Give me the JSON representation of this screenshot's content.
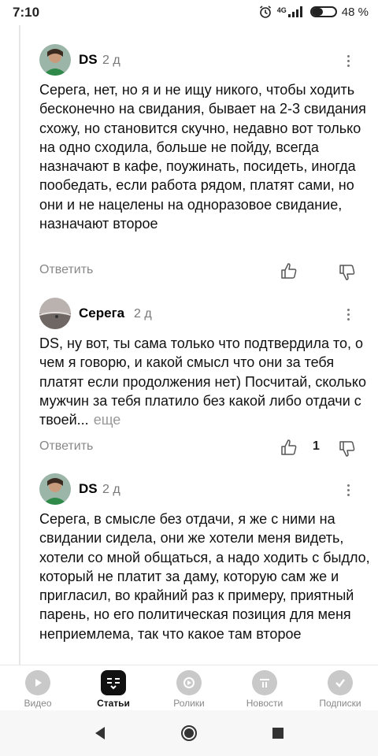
{
  "status_bar": {
    "time": "7:10",
    "network": "4G",
    "battery_percent": "48 %",
    "battery_level": 0.48
  },
  "comments": [
    {
      "author": "DS",
      "age": "2 д",
      "text": "Серега, нет, но я и не ищу никого, чтобы ходить бесконечно на свидания, бывает на 2-3 свидания схожу, но становится скучно, недавно вот только на одно сходила, больше не пойду, всегда назначают в кафе, поужинать, посидеть, иногда пообедать, если работа рядом, платят сами, но они и не нацелены на одноразовое свидание, назначают второе",
      "reply_label": "Ответить"
    },
    {
      "author": "Серега",
      "age": "2 д",
      "text": "DS, ну вот, ты сама только что подтвердила то, о чем я говорю, и какой смысл что они за тебя платят если продолжения нет) Посчитай, сколько мужчин за тебя платило без какой либо отдачи с твоей...",
      "more_label": "еще",
      "reply_label": "Ответить",
      "likes": "1"
    },
    {
      "author": "DS",
      "age": "2 д",
      "text": "Серега, в смысле без отдачи, я же с ними на свидании сидела, они же хотели меня видеть, хотели со мной общаться, а надо ходить с быдло, который не платит за даму, которую сам же и пригласил, во крайний раз к примеру, приятный парень, но его политическая позиция для меня неприемлема, так что какое там второе"
    }
  ],
  "bottom_nav": {
    "items": [
      {
        "label": "Видео",
        "icon": "video-icon"
      },
      {
        "label": "Статьи",
        "icon": "articles-icon"
      },
      {
        "label": "Ролики",
        "icon": "shorts-icon"
      },
      {
        "label": "Новости",
        "icon": "news-icon"
      },
      {
        "label": "Подписки",
        "icon": "subscriptions-icon"
      }
    ],
    "active_index": 1
  },
  "colors": {
    "accent": "#111111",
    "muted": "#888888",
    "inactive_icon": "#c9c9c9"
  }
}
